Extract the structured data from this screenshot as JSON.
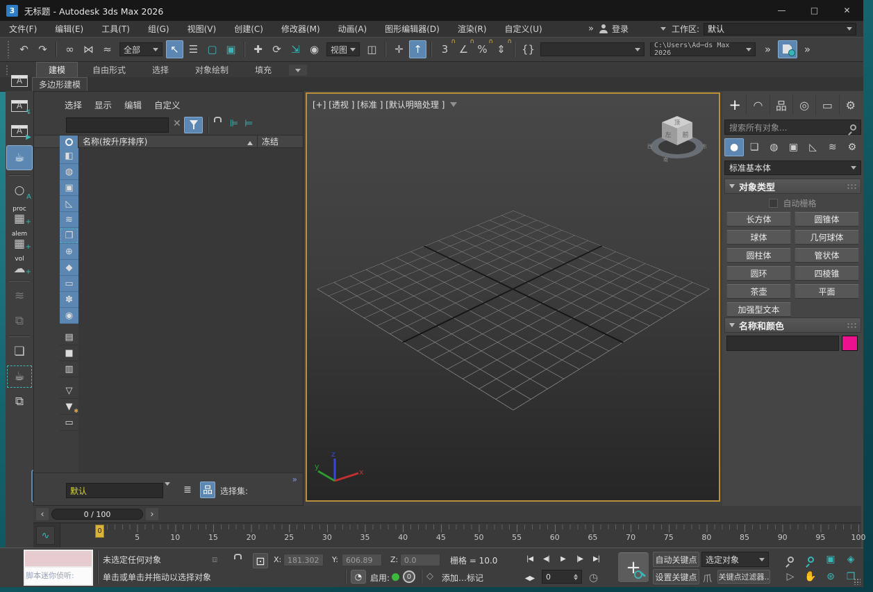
{
  "colors": {
    "accent": "#5b87b2",
    "teal": "#3ab6b6",
    "yellow": "#d9b33c",
    "pink": "#ec128f",
    "green": "#3db93d",
    "vpborder": "#bb903b"
  },
  "window": {
    "title": "无标题 - Autodesk 3ds Max 2026",
    "app_badge": "3",
    "minimize_icon": "—",
    "maximize_icon": "□",
    "close_icon": "✕"
  },
  "menubar": {
    "items": [
      {
        "id": "file",
        "label": "文件(F)"
      },
      {
        "id": "edit",
        "label": "编辑(E)"
      },
      {
        "id": "tools",
        "label": "工具(T)"
      },
      {
        "id": "group",
        "label": "组(G)"
      },
      {
        "id": "views",
        "label": "视图(V)"
      },
      {
        "id": "create",
        "label": "创建(C)"
      },
      {
        "id": "modifiers",
        "label": "修改器(M)"
      },
      {
        "id": "animation",
        "label": "动画(A)"
      },
      {
        "id": "graph-editors",
        "label": "图形编辑器(D)"
      },
      {
        "id": "rendering",
        "label": "渲染(R)"
      },
      {
        "id": "customize",
        "label": "自定义(U)"
      }
    ],
    "overflow": "»",
    "signin": "登录",
    "workspace_label": "工作区:",
    "workspace_value": "默认"
  },
  "toolbar": {
    "items": [
      {
        "t": "icon",
        "name": "undo",
        "g": "↶"
      },
      {
        "t": "icon",
        "name": "redo",
        "g": "↷"
      },
      {
        "t": "sep"
      },
      {
        "t": "icon",
        "name": "select-and-link",
        "g": "∞"
      },
      {
        "t": "icon",
        "name": "unlink-selection",
        "g": "⋈"
      },
      {
        "t": "icon",
        "name": "bind-to-space-warp",
        "g": "≈"
      },
      {
        "t": "dd",
        "name": "selection-filter",
        "text": "全部"
      },
      {
        "t": "icon",
        "name": "select-object",
        "g": "↖",
        "active": true
      },
      {
        "t": "icon",
        "name": "select-by-name",
        "g": "☰"
      },
      {
        "t": "icon",
        "name": "rectangular-selection-region",
        "g": "▢",
        "teal": true
      },
      {
        "t": "icon",
        "name": "window-crossing",
        "g": "▣",
        "teal": true
      },
      {
        "t": "sep"
      },
      {
        "t": "icon",
        "name": "select-and-move",
        "g": "✚"
      },
      {
        "t": "icon",
        "name": "select-and-rotate",
        "g": "⟳"
      },
      {
        "t": "icon",
        "name": "select-and-scale",
        "g": "⇲",
        "teal": true
      },
      {
        "t": "icon",
        "name": "select-and-place",
        "g": "◉"
      },
      {
        "t": "dd",
        "name": "reference-coordinate-system",
        "text": "视图"
      },
      {
        "t": "icon",
        "name": "use-pivot-point-center",
        "g": "◫"
      },
      {
        "t": "sep"
      },
      {
        "t": "icon",
        "name": "select-and-manipulate",
        "g": "✛"
      },
      {
        "t": "icon",
        "name": "keyboard-shortcut-override",
        "g": "↑",
        "active": true
      },
      {
        "t": "sep"
      },
      {
        "t": "icon",
        "name": "snaps-toggle",
        "g": "3",
        "sub": "∩"
      },
      {
        "t": "icon",
        "name": "angle-snap-toggle",
        "g": "∠",
        "sub": "∩"
      },
      {
        "t": "icon",
        "name": "percent-snap-toggle",
        "g": "%",
        "sub": "∩"
      },
      {
        "t": "icon",
        "name": "spinner-snap-toggle",
        "g": "⇕",
        "sub": "∩"
      },
      {
        "t": "sep"
      },
      {
        "t": "icon",
        "name": "edit-named-selection-sets",
        "g": "{}"
      },
      {
        "t": "field",
        "name": "named-selection-sets",
        "text": ""
      },
      {
        "t": "path",
        "name": "project-folder",
        "text": "C:\\Users\\Ad⋯ds Max 2026"
      },
      {
        "t": "icon",
        "name": "toolbar-overflow",
        "g": "»"
      },
      {
        "t": "disk",
        "name": "save-scene"
      },
      {
        "t": "icon",
        "name": "more-toolbars",
        "g": "»"
      }
    ]
  },
  "ribbon": {
    "tabs": [
      {
        "id": "modeling",
        "label": "建模",
        "active": true
      },
      {
        "id": "freeform",
        "label": "自由形式"
      },
      {
        "id": "selection",
        "label": "选择"
      },
      {
        "id": "object-paint",
        "label": "对象绘制"
      },
      {
        "id": "populate",
        "label": "填充"
      }
    ],
    "subtab": "多边形建模"
  },
  "left_toolbar": [
    {
      "name": "script-editor",
      "g": "A",
      "win": true,
      "teal": true
    },
    {
      "name": "maxscript-listener",
      "g": "A",
      "win": true,
      "sub": "↯"
    },
    {
      "name": "macro-recorder",
      "g": "A",
      "win": true,
      "sub": "▶"
    },
    {
      "name": "render-setup",
      "g": "☕",
      "sel": true
    },
    {
      "sep": true
    },
    {
      "name": "light-analysis",
      "g": "○",
      "sub": "A"
    },
    {
      "name": "create-proc",
      "label": "proc",
      "g": "▦",
      "sub": "+"
    },
    {
      "name": "create-alembic",
      "label": "alem",
      "g": "▦",
      "sub": "+"
    },
    {
      "name": "create-volume",
      "label": "vol",
      "g": "☁",
      "sub": "+"
    },
    {
      "sep": true
    },
    {
      "name": "fluids",
      "g": "≋",
      "dis": true
    },
    {
      "name": "scene-converter",
      "g": "⧉",
      "dis": true
    },
    {
      "sep": true
    },
    {
      "name": "batch-render",
      "g": "❏"
    },
    {
      "name": "render-selected",
      "g": "☕",
      "dash": true
    },
    {
      "name": "state-sets",
      "g": "⧉"
    }
  ],
  "explorer": {
    "menu": [
      {
        "id": "select",
        "label": "选择"
      },
      {
        "id": "display",
        "label": "显示"
      },
      {
        "id": "edit",
        "label": "编辑"
      },
      {
        "id": "customize",
        "label": "自定义"
      }
    ],
    "clear_icon": "✕",
    "tree_icons": [
      {
        "name": "expand-tree",
        "g": "⊫"
      },
      {
        "name": "collapse-tree",
        "g": "⊨"
      }
    ],
    "name_header": "名称(按升序排序)",
    "freeze_header": "冻结",
    "strip": [
      {
        "name": "display-geometry",
        "g": "◧",
        "blue": true
      },
      {
        "name": "display-lights",
        "g": "◍",
        "blue": true
      },
      {
        "name": "display-cameras",
        "g": "▣",
        "blue": true
      },
      {
        "name": "display-helpers",
        "g": "◺",
        "blue": true
      },
      {
        "name": "display-space-warps",
        "g": "≋",
        "blue": true
      },
      {
        "name": "display-groups",
        "g": "❐",
        "blue": true,
        "teal": true
      },
      {
        "name": "display-xrefs",
        "g": "⊕",
        "blue": true
      },
      {
        "name": "display-bones",
        "g": "◆",
        "blue": true
      },
      {
        "name": "display-containers",
        "g": "▭",
        "blue": true
      },
      {
        "name": "display-assemblies",
        "g": "✽",
        "blue": true
      },
      {
        "name": "display-object-visibility",
        "g": "◉",
        "blue": true
      },
      {
        "sep": true
      },
      {
        "name": "display-by-layer",
        "g": "▤"
      },
      {
        "name": "display-none",
        "g": "■"
      },
      {
        "name": "display-properties",
        "g": "▥"
      },
      {
        "sep": true
      },
      {
        "name": "filter-combinations",
        "g": "▽"
      },
      {
        "name": "advanced-filter",
        "g": "▼",
        "sub": "✱"
      },
      {
        "name": "pick-container",
        "g": "▭"
      }
    ],
    "display_combo": "默认",
    "bottom_icons": [
      {
        "name": "display-layers",
        "g": "≣"
      },
      {
        "name": "display-hierarchy",
        "g": "品",
        "active": true
      }
    ],
    "selection_set_label": "选择集:",
    "more_icon": "»"
  },
  "viewport": {
    "label": "[+] [透视 ] [标准 ] [默认明暗处理 ]",
    "viewcube": {
      "top": "顶",
      "left": "左",
      "front": "前",
      "east": "东",
      "south": "南",
      "west": "西"
    },
    "axis": {
      "x": "x",
      "y": "y",
      "z": "z"
    }
  },
  "command_panel": {
    "tabs": [
      {
        "name": "create",
        "g": "+",
        "active": true
      },
      {
        "name": "modify",
        "g": "◠"
      },
      {
        "name": "hierarchy",
        "g": "品"
      },
      {
        "name": "motion",
        "g": "◎"
      },
      {
        "name": "display",
        "g": "▭"
      },
      {
        "name": "utilities",
        "g": "⚙"
      }
    ],
    "search_placeholder": "搜索所有对象...",
    "categories": [
      {
        "name": "geometry",
        "g": "●",
        "active": true
      },
      {
        "name": "shapes",
        "g": "❏"
      },
      {
        "name": "lights",
        "g": "◍"
      },
      {
        "name": "cameras",
        "g": "▣"
      },
      {
        "name": "helpers",
        "g": "◺"
      },
      {
        "name": "space-warps",
        "g": "≋"
      },
      {
        "name": "systems",
        "g": "⚙"
      }
    ],
    "subcategory": "标准基本体",
    "object_type": {
      "title": "对象类型",
      "autogrid_label": "自动栅格",
      "buttons": [
        "长方体",
        "圆锥体",
        "球体",
        "几何球体",
        "圆柱体",
        "管状体",
        "圆环",
        "四棱锥",
        "茶壶",
        "平面",
        "加强型文本"
      ]
    },
    "name_color": {
      "title": "名称和颜色",
      "swatch_color": "#ec128f"
    }
  },
  "timeline": {
    "frame_display": "0 / 100",
    "prev_icon": "‹",
    "next_icon": "›",
    "curve_icon": "∿"
  },
  "trackbar": {
    "marker": "0",
    "ticks": [
      5,
      10,
      15,
      20,
      25,
      30,
      35,
      40,
      45,
      50,
      55,
      60,
      65,
      70,
      75,
      80,
      85,
      90,
      95,
      100
    ]
  },
  "statusbar": {
    "listener_label": "脚本迷你侦听:",
    "status": "未选定任何对象",
    "prompt": "单击或单击并拖动以选择对象",
    "isolate_icon": "⧈",
    "absolute_mode_icon": "⊡",
    "coords": {
      "x_label": "X:",
      "x": "181.302",
      "y_label": "Y:",
      "y": "606.89",
      "z_label": "Z:",
      "z": "0.0"
    },
    "grid_info": "栅格 = 10.0",
    "adaptive_icon": "◔",
    "enable_label": "启用:",
    "notifications": "0",
    "marker_icon": "◇",
    "add_marker": "添加…标记",
    "transport": [
      {
        "name": "go-to-start",
        "g": "|◀"
      },
      {
        "name": "previous-frame",
        "g": "◀|"
      },
      {
        "name": "play-animation",
        "g": "▶"
      },
      {
        "name": "next-frame",
        "g": "|▶"
      },
      {
        "name": "go-to-end",
        "g": "▶|"
      }
    ],
    "key_mode_toggle": "◀▶",
    "frame_spinner": "0",
    "time_config_icon": "◷",
    "set_key_icon": "+",
    "auto_key": "自动关键点",
    "set_key": "设置关键点",
    "key_target": "选定对象",
    "key_filters_icon": "爪",
    "key_filters": "关键点过滤器..",
    "nav": [
      {
        "name": "zoom",
        "mag": true
      },
      {
        "name": "zoom-all",
        "mag": true,
        "teal": true
      },
      {
        "name": "zoom-extents",
        "g": "▣",
        "teal": true
      },
      {
        "name": "zoom-extents-all",
        "g": "◈",
        "teal": true
      },
      {
        "name": "field-of-view",
        "g": "▷"
      },
      {
        "name": "pan",
        "g": "✋"
      },
      {
        "name": "orbit",
        "g": "⊛",
        "teal": true
      },
      {
        "name": "maximize-viewport",
        "g": "❐",
        "teal": true
      }
    ]
  }
}
